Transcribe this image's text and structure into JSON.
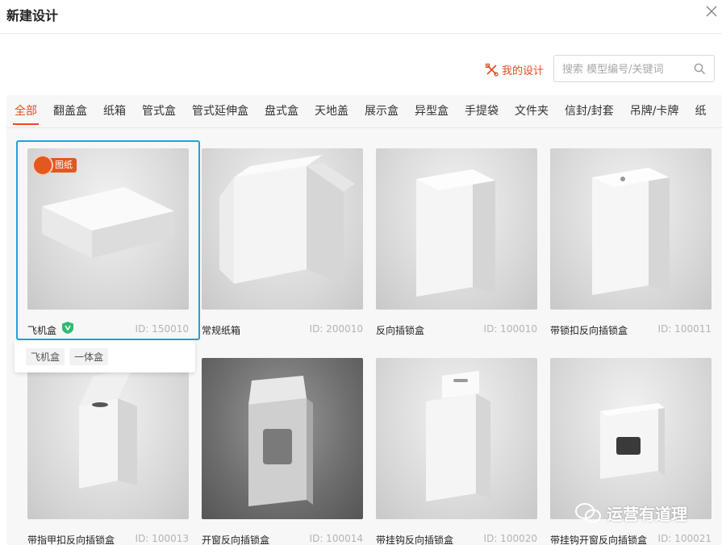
{
  "dialog": {
    "title": "新建设计",
    "close_icon": "close-icon"
  },
  "toolbar": {
    "my_design_label": "我的设计",
    "search_placeholder": "搜索 模型编号/关键词"
  },
  "tabs": [
    "全部",
    "翻盖盒",
    "纸箱",
    "管式盒",
    "管式延伸盒",
    "盘式盒",
    "天地盖",
    "展示盒",
    "异型盒",
    "手提袋",
    "文件夹",
    "信封/封套",
    "吊牌/卡牌",
    "纸"
  ],
  "active_tab": "全部",
  "badge": {
    "label": "图纸"
  },
  "tags": [
    "飞机盒",
    "一体盒"
  ],
  "products": [
    {
      "name": "飞机盒",
      "id": "ID: 150010"
    },
    {
      "name": "常规纸箱",
      "id": "ID: 200010"
    },
    {
      "name": "反向插锁盒",
      "id": "ID: 100010"
    },
    {
      "name": "带锁扣反向插锁盒",
      "id": "ID: 100011"
    },
    {
      "name": "带指甲扣反向插锁盒",
      "id": "ID: 100013"
    },
    {
      "name": "开窗反向插锁盒",
      "id": "ID: 100014"
    },
    {
      "name": "带挂钩反向插锁盒",
      "id": "ID: 100020"
    },
    {
      "name": "带挂钩开窗反向插锁盒",
      "id": "ID: 100021"
    }
  ],
  "watermark": {
    "text": "运营有道理"
  },
  "colors": {
    "accent": "#e84b1f",
    "selected_border": "#1aa4e0",
    "vip_badge": "#2bbd6e"
  }
}
